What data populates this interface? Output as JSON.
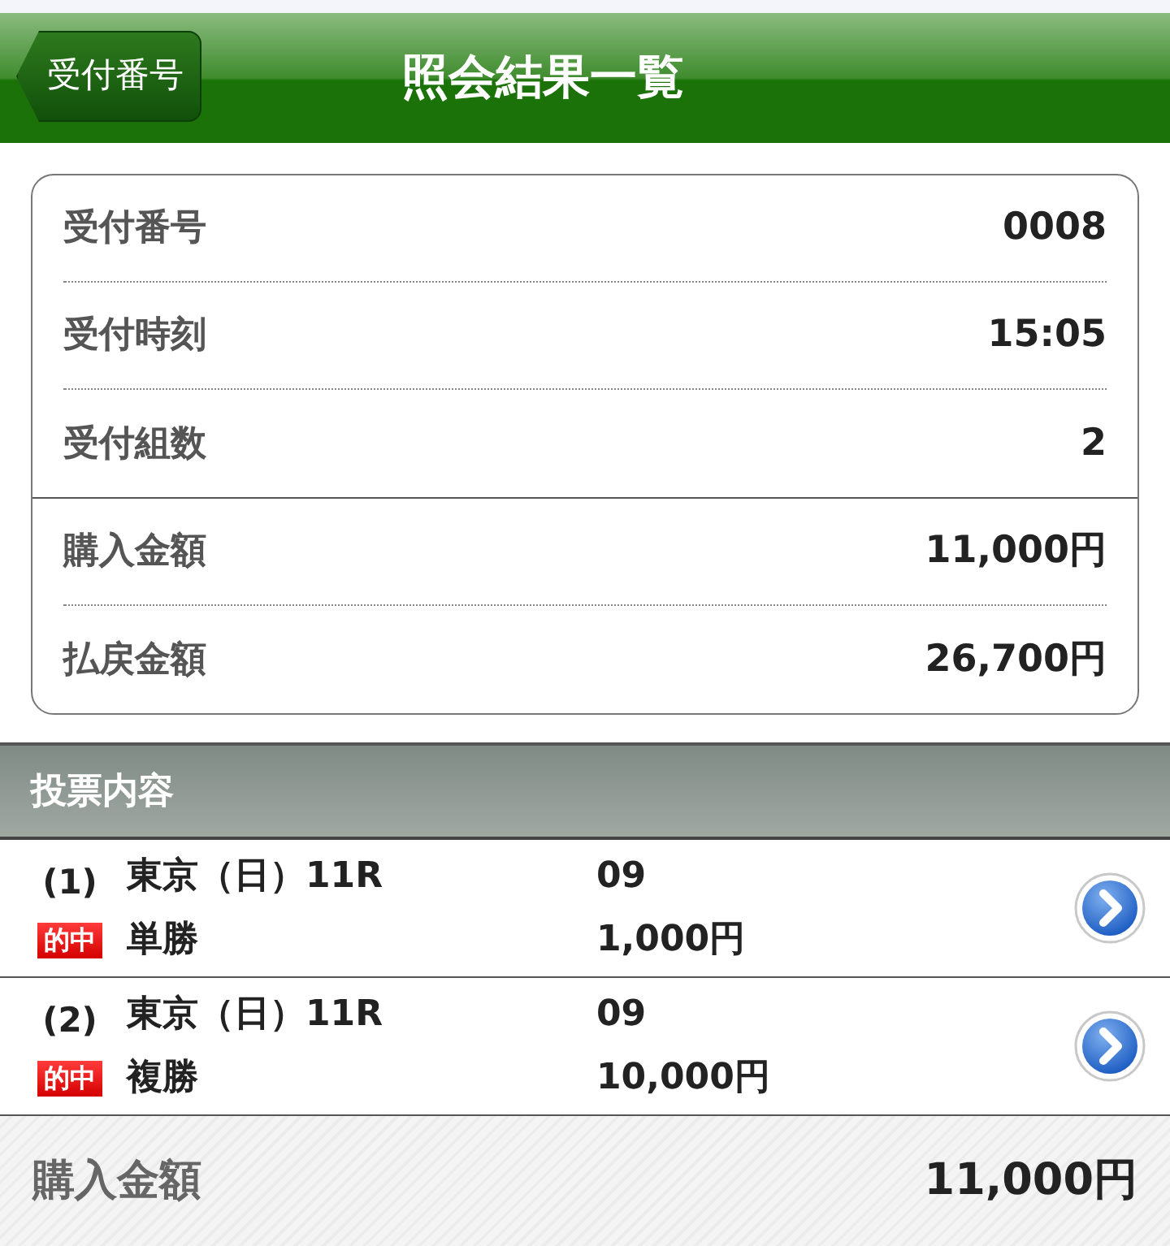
{
  "header": {
    "back_button": "受付番号",
    "title": "照会結果一覧"
  },
  "summary": {
    "groups": [
      [
        {
          "label": "受付番号",
          "value": "0008"
        },
        {
          "label": "受付時刻",
          "value": "15:05"
        },
        {
          "label": "受付組数",
          "value": "2"
        }
      ],
      [
        {
          "label": "購入金額",
          "value": "11,000円"
        },
        {
          "label": "払戻金額",
          "value": "26,700円"
        }
      ]
    ]
  },
  "section": {
    "title": "投票内容"
  },
  "bets": [
    {
      "index": "(1)",
      "badge": "的中",
      "race": "東京（日）11R",
      "type": "単勝",
      "horse": "09",
      "amount": "1,000円"
    },
    {
      "index": "(2)",
      "badge": "的中",
      "race": "東京（日）11R",
      "type": "複勝",
      "horse": "09",
      "amount": "10,000円"
    }
  ],
  "footer": {
    "label": "購入金額",
    "value": "11,000円"
  }
}
